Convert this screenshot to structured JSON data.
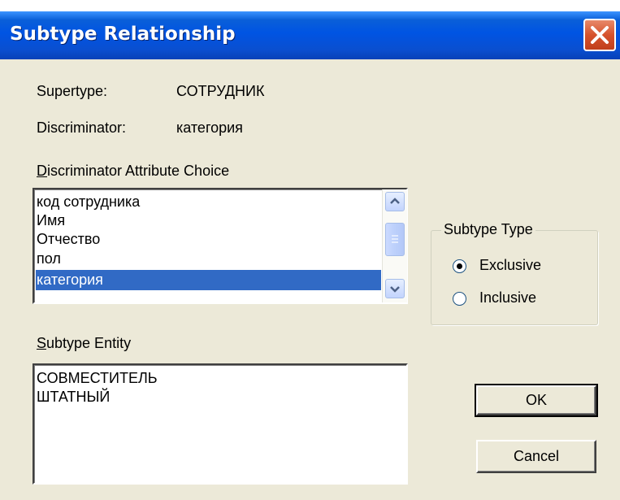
{
  "window": {
    "title": "Subtype Relationship"
  },
  "supertype": {
    "label": "Supertype:",
    "value": "СОТРУДНИК"
  },
  "discriminator": {
    "label": "Discriminator:",
    "value": "категория"
  },
  "attribute_choice": {
    "label_access_key": "D",
    "label_rest": "iscriminator Attribute Choice",
    "items": [
      "код сотрудника",
      "Имя",
      "Отчество",
      "пол",
      "категория"
    ],
    "selected_index": 4
  },
  "subtype_type": {
    "legend": "Subtype Type",
    "options": [
      {
        "label": "Exclusive",
        "checked": true
      },
      {
        "label": "Inclusive",
        "checked": false
      }
    ]
  },
  "subtype_entity": {
    "label_access_key": "S",
    "label_rest": "ubtype Entity",
    "items": [
      "СОВМЕСТИТЕЛЬ",
      "ШТАТНЫЙ"
    ]
  },
  "buttons": {
    "ok": "OK",
    "cancel": "Cancel"
  },
  "colors": {
    "title_bar": "#0054e3",
    "dialog_bg": "#ece9d8",
    "selection": "#316ac5",
    "close_button": "#d6522c"
  }
}
